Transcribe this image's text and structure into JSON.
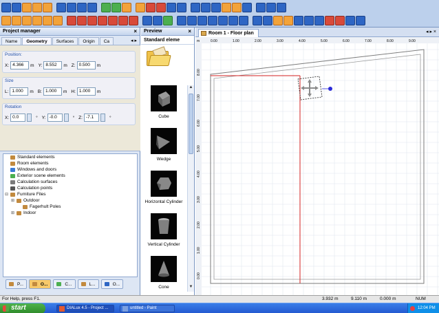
{
  "toolbar": {
    "row1": [
      "b",
      "b",
      "o",
      "o",
      "o",
      "sep",
      "b",
      "b",
      "b",
      "b",
      "sep",
      "g",
      "g",
      "o",
      "sep",
      "o",
      "r",
      "r",
      "b",
      "b",
      "sep",
      "b",
      "b",
      "b",
      "o",
      "o",
      "b",
      "sep",
      "b",
      "b",
      "b"
    ],
    "row2": [
      "o",
      "o",
      "o",
      "o",
      "o",
      "o",
      "sep",
      "r",
      "r",
      "r",
      "r",
      "r",
      "r",
      "r",
      "sep",
      "b",
      "b",
      "g",
      "sep",
      "b",
      "b",
      "b",
      "b",
      "b",
      "b",
      "b",
      "sep",
      "b",
      "b",
      "o",
      "o",
      "b",
      "b",
      "b",
      "r",
      "r",
      "b",
      "b"
    ]
  },
  "project_manager": {
    "title": "Project manager",
    "close": "×",
    "tabs": [
      "Name",
      "Geometry",
      "Surfaces",
      "Origin",
      "Ca"
    ],
    "active_tab": "Geometry",
    "tab_nav": "◂ ▸",
    "position": {
      "title": "Position:",
      "x_label": "X:",
      "x_value": "4.366",
      "x_unit": "m",
      "y_label": "Y:",
      "y_value": "8.552",
      "y_unit": "m",
      "z_label": "Z:",
      "z_value": "0.500",
      "z_unit": "m"
    },
    "size": {
      "title": "Size",
      "l_label": "L:",
      "l_value": "1.000",
      "l_unit": "m",
      "b_label": "B:",
      "b_value": "1.000",
      "b_unit": "m",
      "h_label": "H:",
      "h_value": "1.000",
      "h_unit": "m"
    },
    "rotation": {
      "title": "Rotation",
      "x_label": "X:",
      "x_value": "0.0",
      "x_unit": "°",
      "y_label": "Y:",
      "y_value": "-0.0",
      "y_unit": "°",
      "z_label": "Z:",
      "z_value": "-7.1",
      "z_unit": "°"
    },
    "tree": [
      {
        "label": "Standard elements",
        "expander": ""
      },
      {
        "label": "Room elements",
        "expander": ""
      },
      {
        "label": "Windows and doors",
        "expander": ""
      },
      {
        "label": "Exterior scene elements",
        "expander": ""
      },
      {
        "label": "Calculation surfaces",
        "expander": ""
      },
      {
        "label": "Calculation points",
        "expander": ""
      },
      {
        "label": "Furniture Files",
        "expander": "⊟"
      },
      {
        "label": "Outdoor",
        "expander": "⊞"
      },
      {
        "label": "Fagerhult Poles",
        "expander": ""
      },
      {
        "label": "Indoor",
        "expander": "⊞"
      }
    ],
    "bottom_tabs": [
      "P...",
      "O...",
      "C...",
      "L...",
      "O..."
    ]
  },
  "preview": {
    "title": "Preview",
    "close": "×",
    "heading": "Standard eleme",
    "items": [
      {
        "label": "Cube",
        "shape": "cube"
      },
      {
        "label": "Wedge",
        "shape": "wedge"
      },
      {
        "label": "Horizontal Cylinder",
        "shape": "hcyl"
      },
      {
        "label": "Vertical Cylinder",
        "shape": "vcyl"
      },
      {
        "label": "Cone",
        "shape": "cone"
      }
    ],
    "scroll_up": "▲",
    "scroll_down": "▼"
  },
  "document": {
    "tab_label": "Room 1 - Floor plan",
    "controls": "◂ ▸ ×",
    "ruler_top": [
      "0.00",
      "1.00",
      "2.00",
      "3.00",
      "4.00",
      "5.00",
      "6.00",
      "7.00",
      "8.00",
      "9.00"
    ],
    "ruler_left": [
      "8.00",
      "7.00",
      "6.00",
      "5.00",
      "4.00",
      "3.00",
      "2.00",
      "1.00",
      "0.00"
    ],
    "unit": "m"
  },
  "status": {
    "help": "For Help, press F1.",
    "x": "3.932 m",
    "y": "9.110 m",
    "z": "0.000 m",
    "num": "NUM"
  },
  "taskbar": {
    "start": "start",
    "tasks": [
      "DIALux 4.5 - Project ...",
      "untitled - Paint"
    ],
    "time": "12:04 PM"
  }
}
